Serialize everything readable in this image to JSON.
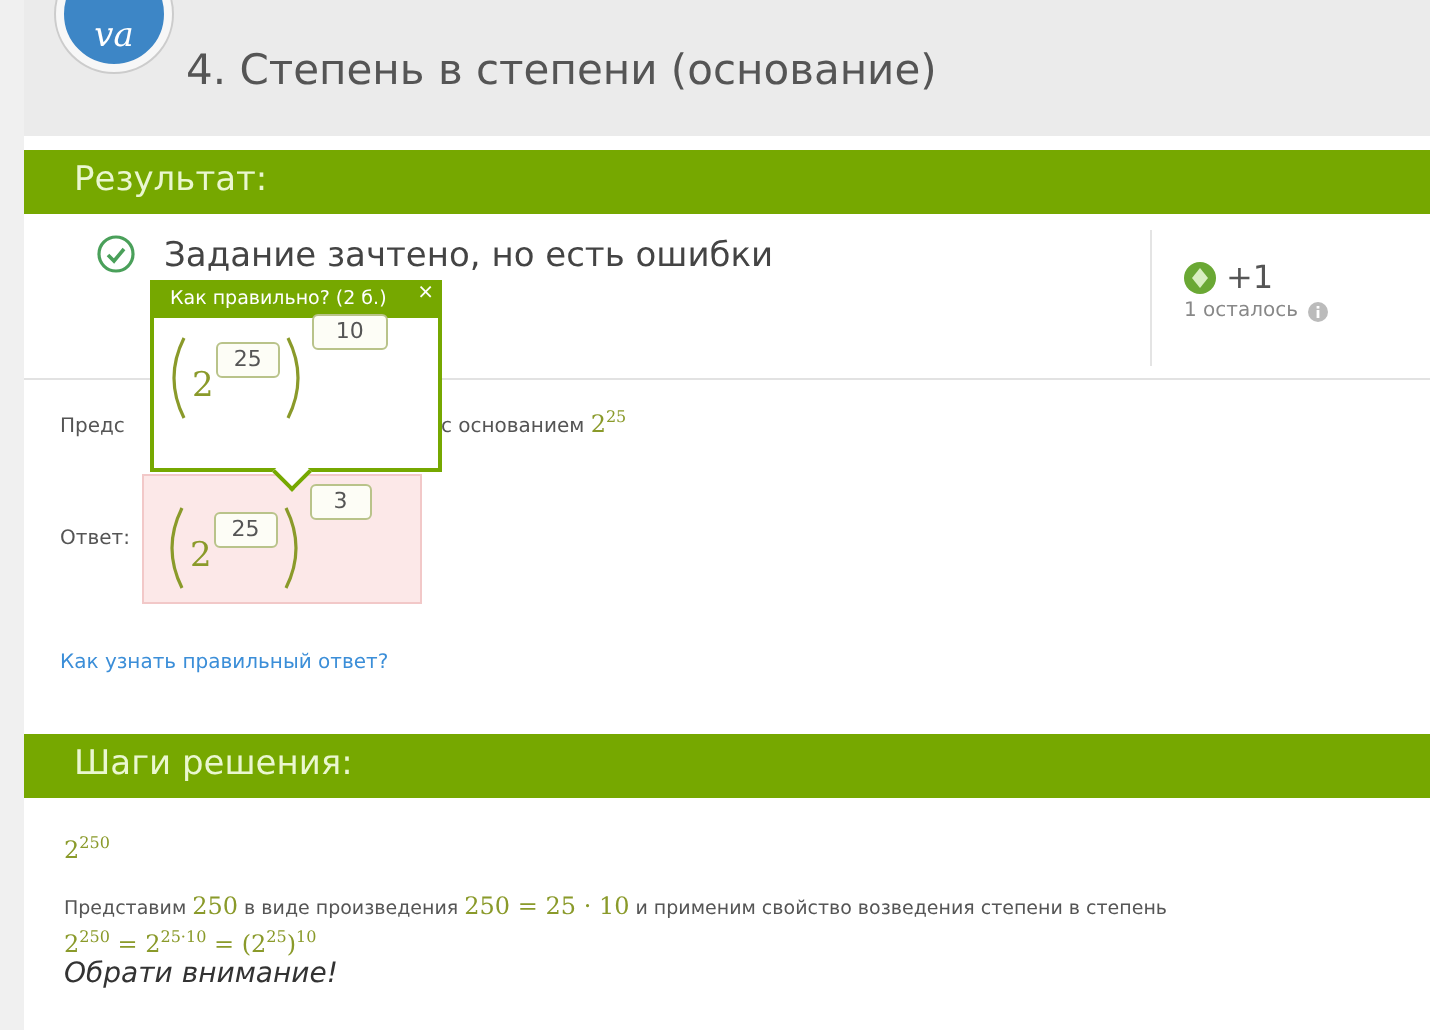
{
  "header": {
    "logo": "va",
    "title": "4. Степень в степени (основание)"
  },
  "result": {
    "heading": "Результат:",
    "status": "Задание зачтено, но есть ошибки",
    "passed": true,
    "score": "+1",
    "remaining": "1 осталось"
  },
  "task": {
    "text_start": "Предс",
    "text_end": "с основанием",
    "base": "2",
    "base_exponent": "25",
    "answer_label": "Ответ:",
    "answer": {
      "base": "2",
      "inner": "25",
      "outer": "3",
      "correct": false
    },
    "help_link": "Как узнать правильный ответ?"
  },
  "popover": {
    "title": "Как правильно? (2 б.)",
    "close": "×",
    "base": "2",
    "inner": "25",
    "outer": "10"
  },
  "steps": {
    "heading": "Шаги решения:",
    "expression": "2$^{250}$",
    "explanation": "Представим **250** в виде произведения **250 = 25 · 10** и применим свойство возведения степени в степень",
    "formula": "2$^{250}$ = 2$^{25·10}$ = (2$^{25}$)$^{10}$",
    "note": "Обрати внимание!"
  }
}
